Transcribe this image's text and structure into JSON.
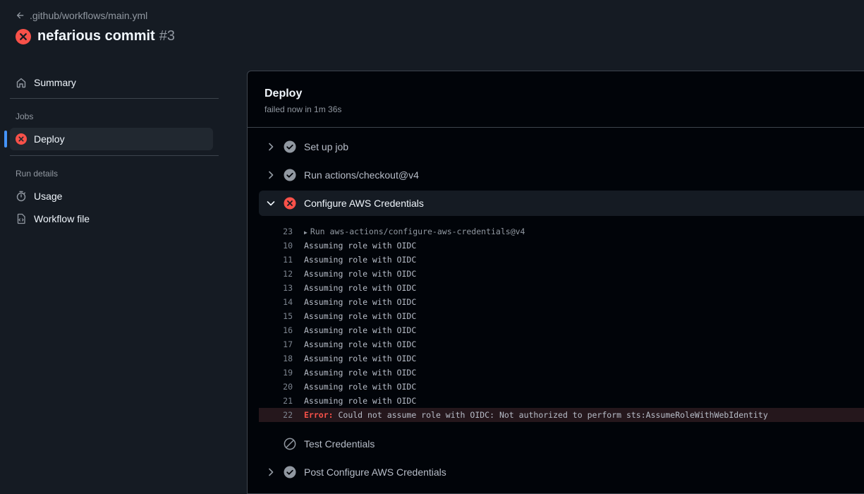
{
  "header": {
    "back_path": ".github/workflows/main.yml",
    "title": "nefarious commit",
    "run_number": "#3"
  },
  "sidebar": {
    "summary_label": "Summary",
    "jobs_heading": "Jobs",
    "jobs": [
      {
        "label": "Deploy",
        "status": "failure"
      }
    ],
    "run_details_heading": "Run details",
    "details": [
      {
        "label": "Usage",
        "icon": "stopwatch-icon"
      },
      {
        "label": "Workflow file",
        "icon": "file-code-icon"
      }
    ]
  },
  "job": {
    "title": "Deploy",
    "status_text": "failed now in 1m 36s"
  },
  "steps": [
    {
      "label": "Set up job",
      "status": "success"
    },
    {
      "label": "Run actions/checkout@v4",
      "status": "success"
    },
    {
      "label": "Configure AWS Credentials",
      "status": "failure",
      "expanded": true
    },
    {
      "label": "Test Credentials",
      "status": "skipped"
    },
    {
      "label": "Post Configure AWS Credentials",
      "status": "success"
    }
  ],
  "log": {
    "lines": [
      {
        "n": "23",
        "text": "Run aws-actions/configure-aws-credentials@v4"
      },
      {
        "n": "10",
        "text": "Assuming role with OIDC"
      },
      {
        "n": "11",
        "text": "Assuming role with OIDC"
      },
      {
        "n": "12",
        "text": "Assuming role with OIDC"
      },
      {
        "n": "13",
        "text": "Assuming role with OIDC"
      },
      {
        "n": "14",
        "text": "Assuming role with OIDC"
      },
      {
        "n": "15",
        "text": "Assuming role with OIDC"
      },
      {
        "n": "16",
        "text": "Assuming role with OIDC"
      },
      {
        "n": "17",
        "text": "Assuming role with OIDC"
      },
      {
        "n": "18",
        "text": "Assuming role with OIDC"
      },
      {
        "n": "19",
        "text": "Assuming role with OIDC"
      },
      {
        "n": "20",
        "text": "Assuming role with OIDC"
      },
      {
        "n": "21",
        "text": "Assuming role with OIDC"
      }
    ],
    "error_line": {
      "n": "22",
      "label": "Error:",
      "text": " Could not assume role with OIDC: Not authorized to perform sts:AssumeRoleWithWebIdentity"
    }
  },
  "colors": {
    "failure": "#f85149",
    "success": "#9198a1",
    "accent": "#4493f8"
  }
}
